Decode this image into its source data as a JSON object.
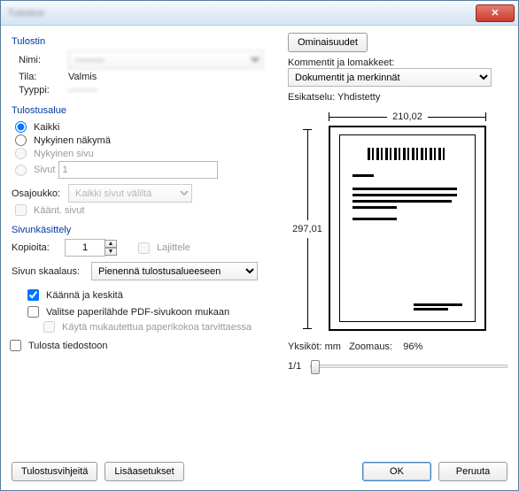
{
  "window": {
    "title": "Tulostus"
  },
  "printer": {
    "section": "Tulostin",
    "name_label": "Nimi:",
    "name_value": "———",
    "status_label": "Tila:",
    "status_value": "Valmis",
    "type_label": "Tyyppi:",
    "type_value": "———",
    "properties_btn": "Ominaisuudet"
  },
  "comments": {
    "label": "Kommentit ja lomakkeet:",
    "value": "Dokumentit ja merkinnät"
  },
  "range": {
    "section": "Tulostusalue",
    "all": "Kaikki",
    "view": "Nykyinen näkymä",
    "page": "Nykyinen sivu",
    "pages": "Sivut",
    "pages_value": "1",
    "subset_label": "Osajoukko:",
    "subset_value": "Kaikki sivut väliltä",
    "reverse": "Käänt. sivut"
  },
  "handling": {
    "section": "Sivunkäsittely",
    "copies_label": "Kopioita:",
    "copies_value": "1",
    "collate": "Lajittele",
    "scaling_label": "Sivun skaalaus:",
    "scaling_value": "Pienennä tulostusalueeseen",
    "rotate": "Käännä ja keskitä",
    "paper_source": "Valitse paperilähde PDF-sivukoon mukaan",
    "custom_paper": "Käytä mukautettua paperikokoa tarvittaessa"
  },
  "print_to_file": "Tulosta tiedostoon",
  "preview": {
    "label": "Esikatselu: Yhdistetty",
    "width": "210,02",
    "height": "297,01",
    "units_label": "Yksiköt:",
    "units_value": "mm",
    "zoom_label": "Zoomaus:",
    "zoom_value": "96%",
    "page_indicator": "1/1"
  },
  "buttons": {
    "tips": "Tulostusvihjeitä",
    "advanced": "Lisäasetukset",
    "ok": "OK",
    "cancel": "Peruuta"
  }
}
